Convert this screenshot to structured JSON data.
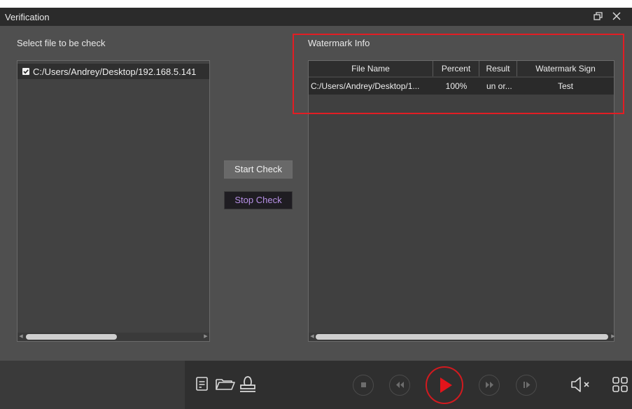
{
  "window": {
    "title": "Verification"
  },
  "left_panel": {
    "label": "Select file to be check",
    "files": [
      {
        "path": "C:/Users/Andrey/Desktop/192.168.5.141",
        "checked": true
      }
    ]
  },
  "actions": {
    "start_label": "Start Check",
    "stop_label": "Stop Check"
  },
  "right_panel": {
    "label": "Watermark Info",
    "columns": [
      "File Name",
      "Percent",
      "Result",
      "Watermark Sign"
    ],
    "rows": [
      {
        "file_name": "C:/Users/Andrey/Desktop/1...",
        "percent": "100%",
        "result": "un or...",
        "sign": "Test"
      }
    ]
  },
  "toolbar": {
    "icons": [
      "log-icon",
      "folder-open-icon",
      "stamp-icon",
      "stop-icon",
      "rewind-icon",
      "play-icon",
      "fast-forward-icon",
      "step-forward-icon",
      "mute-icon",
      "layout-grid-icon"
    ]
  },
  "colors": {
    "dialog_bg": "#4f4f4f",
    "titlebar_bg": "#2b2b2b",
    "highlight": "#e21d24",
    "stop_text": "#b790e6",
    "play_ring": "#d21a1f"
  }
}
